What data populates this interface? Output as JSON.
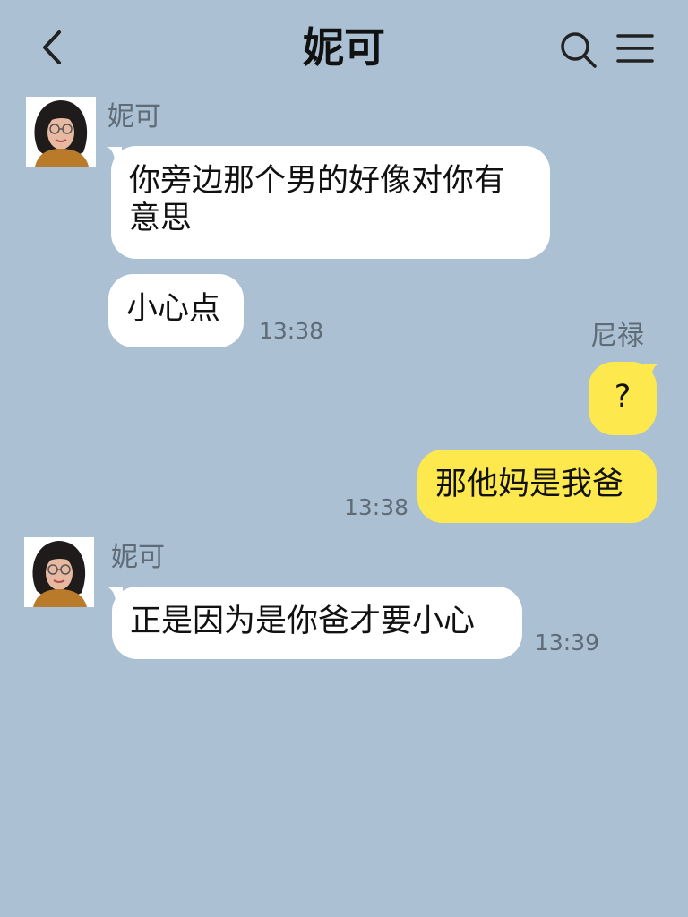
{
  "header": {
    "title": "妮可",
    "back_icon": "chevron-left-icon",
    "search_icon": "search-icon",
    "menu_icon": "menu-icon"
  },
  "messages": [
    {
      "sender": "妮可",
      "side": "incoming",
      "text": "你旁边那个男的好像对你有意思",
      "time": ""
    },
    {
      "sender": "妮可",
      "side": "incoming",
      "text": "小心点",
      "time": "13:38"
    },
    {
      "sender": "尼禄",
      "side": "outgoing",
      "text": "?",
      "time": ""
    },
    {
      "sender": "尼禄",
      "side": "outgoing",
      "text": "那他妈是我爸",
      "time": "13:38"
    },
    {
      "sender": "妮可",
      "side": "incoming",
      "text": "正是因为是你爸才要小心",
      "time": "13:39"
    }
  ],
  "colors": {
    "background": "#abc1d3",
    "incoming_bubble": "#ffffff",
    "outgoing_bubble": "#fde84e",
    "meta_text": "#5f6b77"
  }
}
